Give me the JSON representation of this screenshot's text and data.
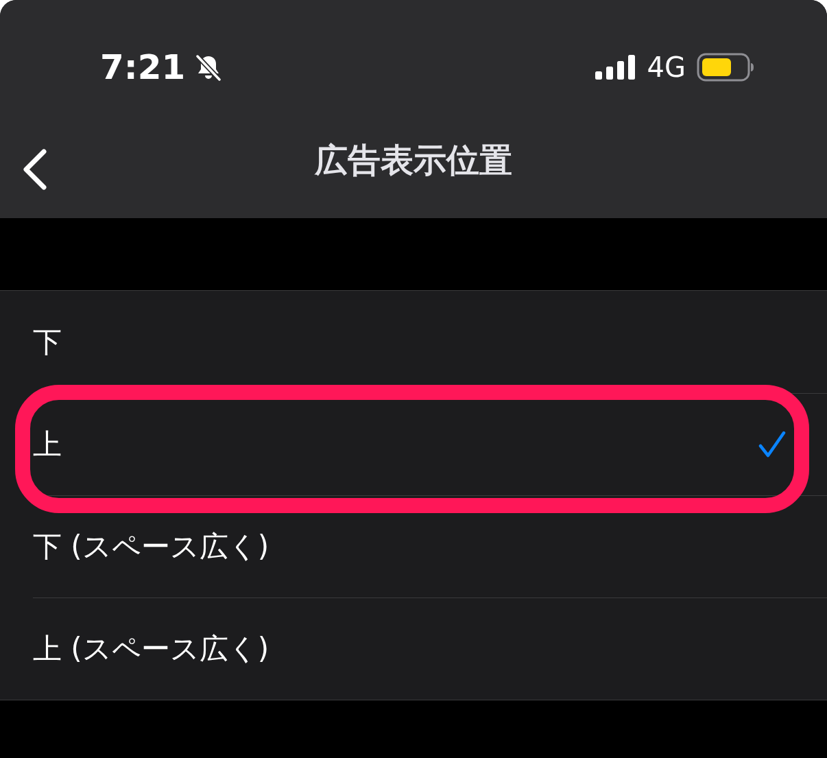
{
  "status_bar": {
    "time": "7:21",
    "network": "4G"
  },
  "nav": {
    "title": "広告表示位置"
  },
  "options": [
    {
      "label": "下",
      "selected": false,
      "highlighted": false
    },
    {
      "label": "上",
      "selected": true,
      "highlighted": true
    },
    {
      "label": "下 (スペース広く)",
      "selected": false,
      "highlighted": false
    },
    {
      "label": "上 (スペース広く)",
      "selected": false,
      "highlighted": false
    }
  ]
}
